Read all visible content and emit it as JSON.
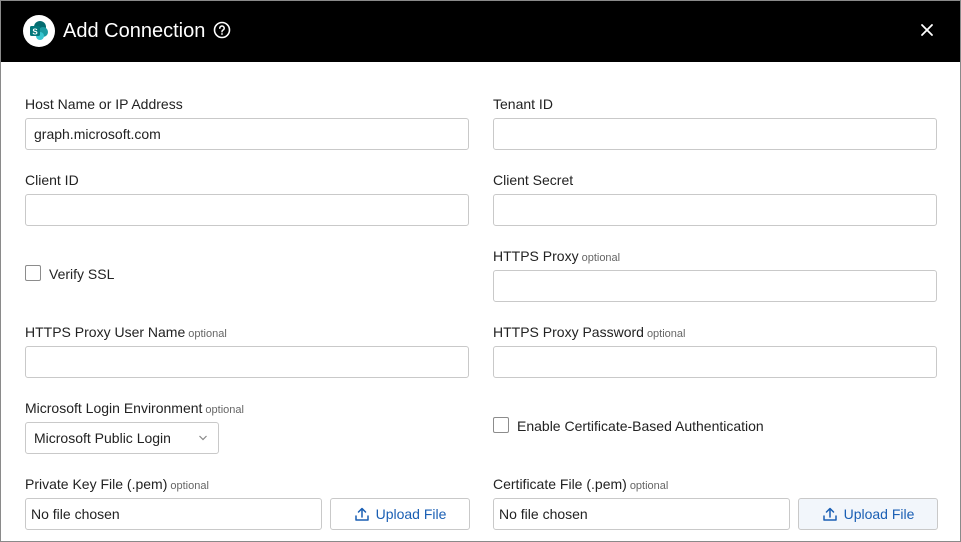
{
  "dialog": {
    "title": "Add Connection",
    "accent": "#1a5fb4",
    "header_color": "#000000"
  },
  "icons": {
    "logo": "sharepoint-logo-icon",
    "help": "help-circle-icon",
    "close": "close-icon",
    "chevron": "chevron-down-icon",
    "upload": "upload-icon"
  },
  "fields": {
    "host": {
      "label": "Host Name or IP Address",
      "value": "graph.microsoft.com"
    },
    "tenant": {
      "label": "Tenant ID",
      "value": ""
    },
    "client_id": {
      "label": "Client ID",
      "value": ""
    },
    "client_secret": {
      "label": "Client Secret",
      "value": ""
    },
    "verify_ssl": {
      "label": "Verify SSL",
      "checked": false
    },
    "https_proxy": {
      "label": "HTTPS Proxy",
      "optional": "optional",
      "value": ""
    },
    "proxy_user": {
      "label": "HTTPS Proxy User Name",
      "optional": "optional",
      "value": ""
    },
    "proxy_password": {
      "label": "HTTPS Proxy Password",
      "optional": "optional",
      "value": ""
    },
    "login_env": {
      "label": "Microsoft Login Environment",
      "optional": "optional",
      "selected": "Microsoft Public Login"
    },
    "cert_auth": {
      "label": "Enable Certificate-Based Authentication",
      "checked": false
    },
    "private_key": {
      "label": "Private Key File (.pem)",
      "optional": "optional",
      "file_text": "No file chosen",
      "button": "Upload File"
    },
    "certificate": {
      "label": "Certificate File (.pem)",
      "optional": "optional",
      "file_text": "No file chosen",
      "button": "Upload File"
    }
  }
}
